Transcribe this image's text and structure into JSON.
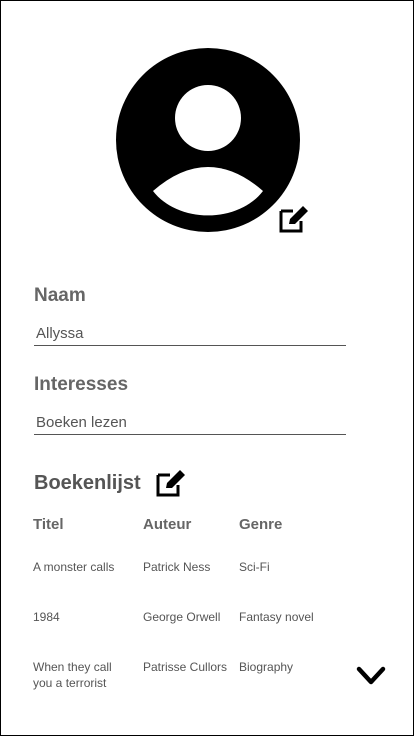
{
  "profile": {
    "name_label": "Naam",
    "name_value": "Allyssa",
    "interests_label": "Interesses",
    "interests_value": "Boeken lezen"
  },
  "books": {
    "title": "Boekenlijst",
    "columns": [
      "Titel",
      "Auteur",
      "Genre"
    ],
    "rows": [
      {
        "title": "A monster calls",
        "author": "Patrick Ness",
        "genre": "Sci-Fi"
      },
      {
        "title": "1984",
        "author": "George Orwell",
        "genre": "Fantasy novel"
      },
      {
        "title": "When they call you a terrorist",
        "author": "Patrisse Cullors",
        "genre": "Biography"
      }
    ]
  },
  "icons": {
    "avatar": "user-avatar-icon",
    "edit": "edit-icon",
    "more": "chevron-down-icon"
  },
  "colors": {
    "text": "#555555",
    "label": "#666666",
    "icon": "#000000"
  }
}
